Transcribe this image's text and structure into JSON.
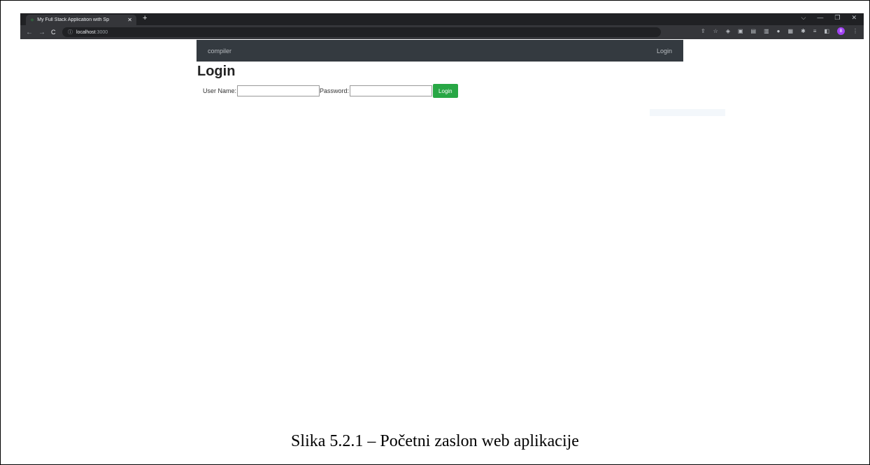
{
  "browser": {
    "tab_title": "My Full Stack Application with Sp",
    "url_host": "localhost",
    "url_port": ":3000",
    "profile_initial": "B"
  },
  "app": {
    "brand": "compiler",
    "nav_login": "Login",
    "heading": "Login",
    "username_label": "User Name:",
    "username_value": "",
    "password_label": "Password:",
    "password_value": "",
    "login_button": "Login"
  },
  "caption": "Slika 5.2.1 – Početni zaslon web aplikacije",
  "colors": {
    "navbar_bg": "#343a40",
    "login_button_bg": "#28a745",
    "browser_chrome": "#202124"
  }
}
